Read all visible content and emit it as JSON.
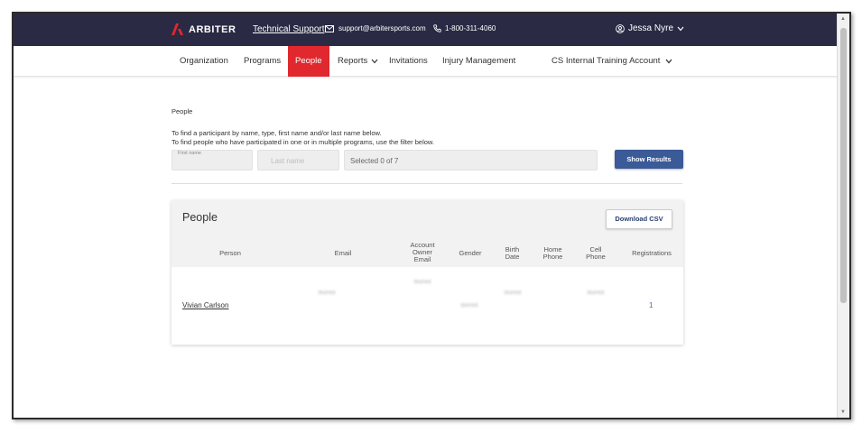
{
  "header": {
    "brand": "ARBITER",
    "tech_support": "Technical Support",
    "email": "support@arbitersports.com",
    "phone": "1-800-311-4060",
    "user": "Jessa Nyre"
  },
  "nav": {
    "items": [
      "Organization",
      "Programs",
      "People",
      "Reports",
      "Invitations",
      "Injury Management"
    ],
    "active": "People",
    "account": "CS Internal Training Account"
  },
  "page": {
    "breadcrumb": "People",
    "help_line_1": "To find a participant by name, type, first name and/or last name below.",
    "help_line_2": "To find people who have participated in one or in multiple programs, use the filter below."
  },
  "filters": {
    "first_name_label": "First name",
    "last_name_placeholder": "Last name",
    "programs_selected": "Selected 0 of 7",
    "show_results": "Show Results"
  },
  "people_table": {
    "title": "People",
    "download_csv": "Download CSV",
    "columns": [
      "Person",
      "Email",
      "Account Owner Email",
      "Gender",
      "Birth Date",
      "Home Phone",
      "Cell Phone",
      "Registrations"
    ],
    "rows": [
      {
        "person": "Vivian Carlson",
        "email": "blurred",
        "account_owner_email": "blurred",
        "gender": "blurred",
        "birth_date": "blurred",
        "home_phone": "",
        "cell_phone": "blurred",
        "registrations": "1"
      }
    ]
  },
  "colors": {
    "topbar": "#2a2a44",
    "active_nav": "#e0282e",
    "primary_button": "#3a5a98",
    "link_blue": "#3a6ab5"
  }
}
